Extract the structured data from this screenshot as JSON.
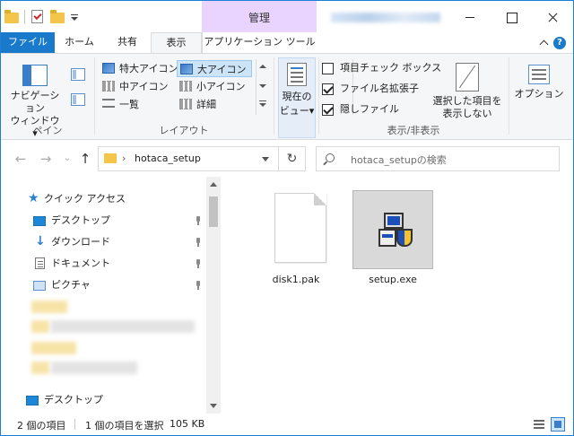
{
  "window": {
    "context_tab_title": "管理",
    "controls": {
      "minimize": "minimize",
      "maximize": "maximize",
      "close": "close"
    }
  },
  "tabs": {
    "file": "ファイル",
    "home": "ホーム",
    "share": "共有",
    "view": "表示",
    "app_tools": "アプリケーション ツール"
  },
  "ribbon": {
    "pane": {
      "nav_pane_line1": "ナビゲーション",
      "nav_pane_line2": "ウィンドウ",
      "label": "ペイン"
    },
    "layout": {
      "extra_large_icons": "特大アイコン",
      "large_icons": "大アイコン",
      "medium_icons": "中アイコン",
      "small_icons": "小アイコン",
      "list": "一覧",
      "details": "詳細",
      "label": "レイアウト",
      "selected": "large_icons"
    },
    "current_view": {
      "line1": "現在の",
      "line2": "ビュー"
    },
    "show_hide": {
      "item_checkboxes": "項目チェック ボックス",
      "item_checkboxes_checked": false,
      "file_extensions": "ファイル名拡張子",
      "file_extensions_checked": true,
      "hidden_items": "隠しファイル",
      "hidden_items_checked": true,
      "hide_selected_line1": "選択した項目を",
      "hide_selected_line2": "表示しない",
      "label": "表示/非表示"
    },
    "options": "オプション"
  },
  "navigation": {
    "path": "hotaca_setup",
    "search_placeholder": "hotaca_setupの検索"
  },
  "nav_pane": {
    "quick_access": "クイック アクセス",
    "items": [
      {
        "label": "デスクトップ",
        "icon": "desktop-icon",
        "pinned": true
      },
      {
        "label": "ダウンロード",
        "icon": "download-icon",
        "pinned": true
      },
      {
        "label": "ドキュメント",
        "icon": "document-icon",
        "pinned": true
      },
      {
        "label": "ピクチャ",
        "icon": "pictures-icon",
        "pinned": true
      }
    ],
    "desktop": "デスクトップ"
  },
  "files": [
    {
      "name": "disk1.pak",
      "icon": "blank-file-icon",
      "selected": false
    },
    {
      "name": "setup.exe",
      "icon": "installer-icon",
      "selected": true
    }
  ],
  "status": {
    "item_count": "2 個の項目",
    "selection": "1 個の項目を選択",
    "size": "105 KB"
  },
  "colors": {
    "accent": "#1979ca",
    "context_tab": "#e8d4ff",
    "selection": "#d9d9d9",
    "ribbon_bg": "#f5f6f7"
  }
}
